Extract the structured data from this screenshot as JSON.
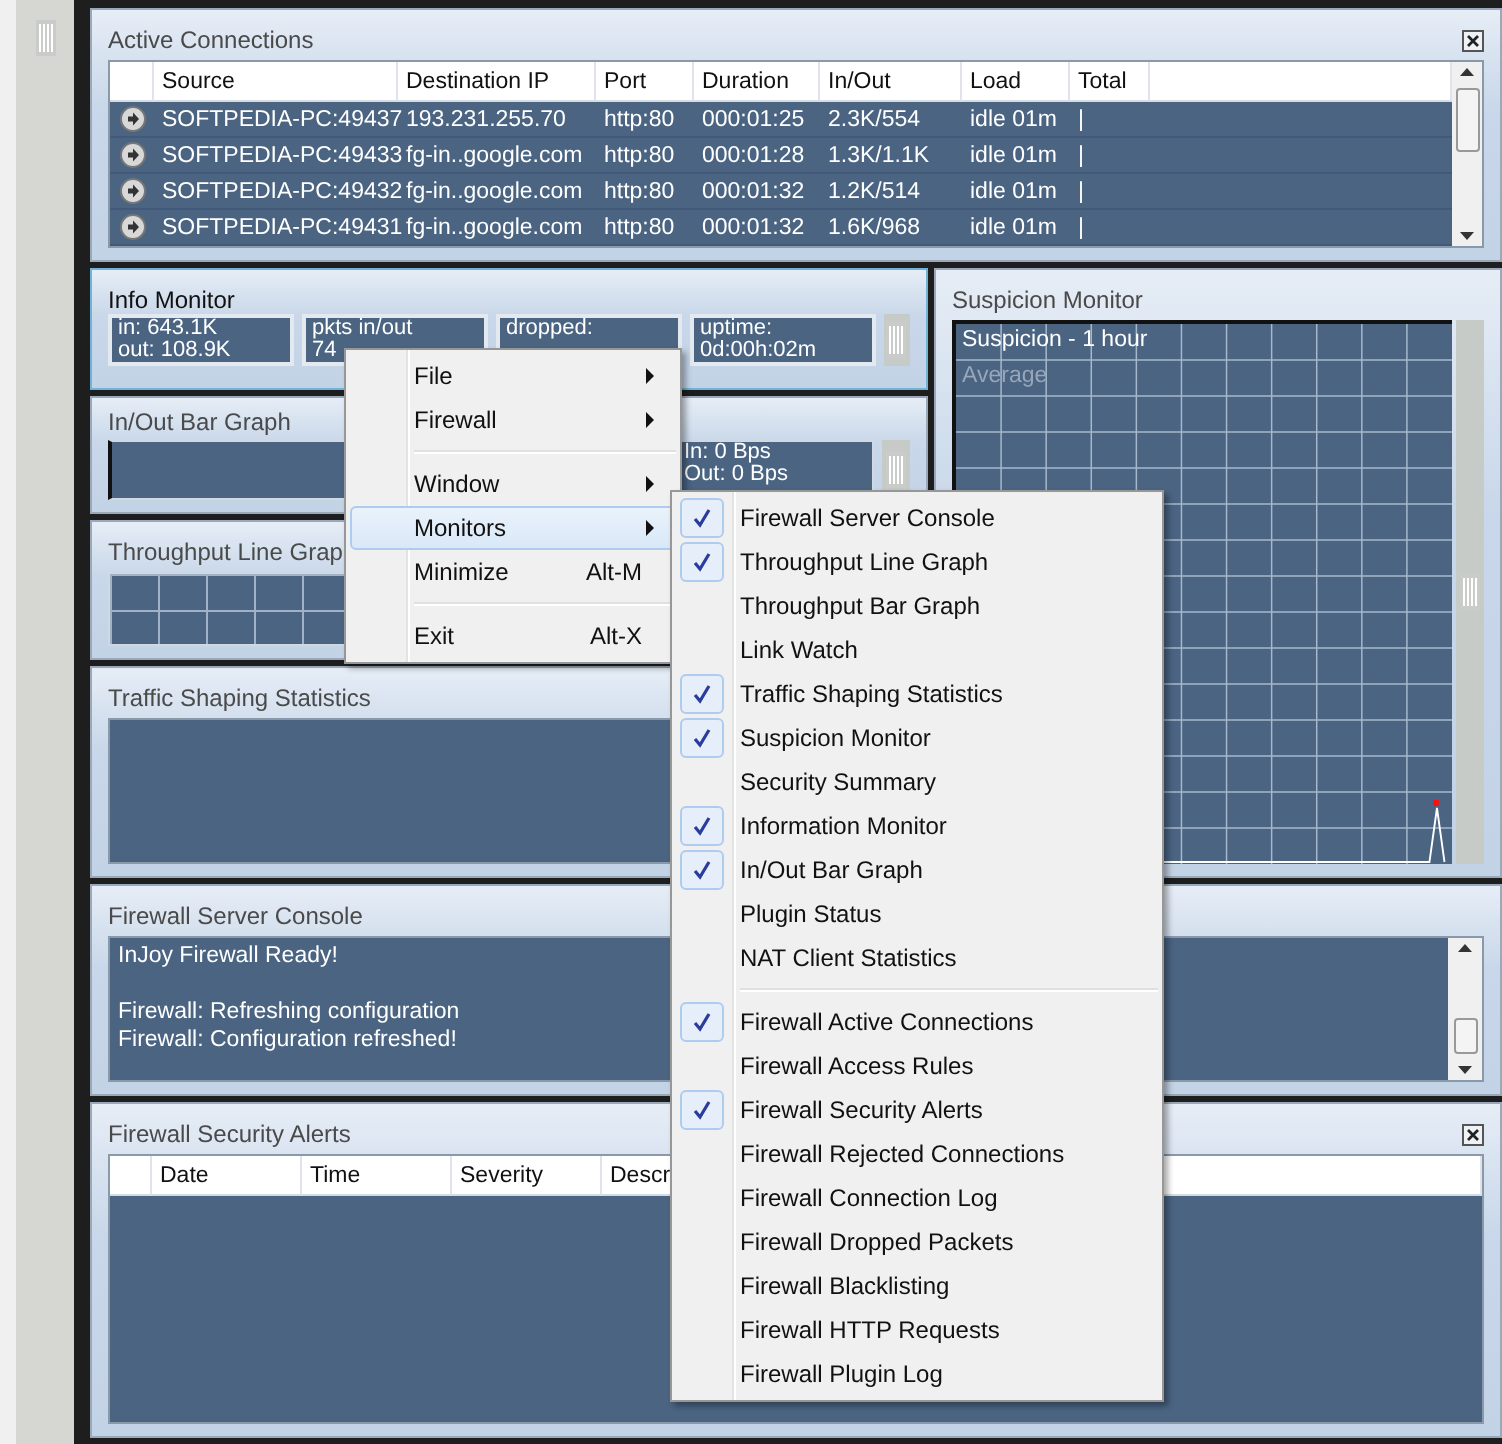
{
  "active_connections": {
    "title": "Active Connections",
    "columns": [
      "Source",
      "Destination IP",
      "Port",
      "Duration",
      "In/Out",
      "Load",
      "Total"
    ],
    "rows": [
      {
        "source": "SOFTPEDIA-PC:49437",
        "destination_ip": "193.231.255.70",
        "port": "http:80",
        "duration": "000:01:25",
        "in_out": "2.3K/554",
        "load": "idle 01m",
        "total": "|"
      },
      {
        "source": "SOFTPEDIA-PC:49433",
        "destination_ip": "fg-in..google.com",
        "port": "http:80",
        "duration": "000:01:28",
        "in_out": "1.3K/1.1K",
        "load": "idle 01m",
        "total": "|"
      },
      {
        "source": "SOFTPEDIA-PC:49432",
        "destination_ip": "fg-in..google.com",
        "port": "http:80",
        "duration": "000:01:32",
        "in_out": "1.2K/514",
        "load": "idle 01m",
        "total": "|"
      },
      {
        "source": "SOFTPEDIA-PC:49431",
        "destination_ip": "fg-in..google.com",
        "port": "http:80",
        "duration": "000:01:32",
        "in_out": "1.6K/968",
        "load": "idle 01m",
        "total": "|"
      }
    ]
  },
  "info_monitor": {
    "title": "Info Monitor",
    "stats": [
      {
        "lines": [
          "in: 643.1K",
          "out: 108.9K"
        ]
      },
      {
        "lines": [
          "pkts in/out",
          "74"
        ]
      },
      {
        "lines": [
          "dropped:"
        ]
      },
      {
        "lines": [
          "uptime:",
          "0d:00h:02m"
        ]
      }
    ]
  },
  "in_out_bar_graph": {
    "title": "In/Out Bar Graph",
    "readings": [
      "In: 0 Bps",
      "Out: 0 Bps"
    ]
  },
  "throughput_line_graph": {
    "title": "Throughput Line Grap"
  },
  "traffic_shaping_statistics": {
    "title": "Traffic Shaping Statistics"
  },
  "suspicion_monitor": {
    "title": "Suspicion Monitor",
    "graph_title": "Suspicion - 1 hour",
    "legend": "Average"
  },
  "firewall_server_console": {
    "title": "Firewall Server Console",
    "lines": [
      {
        "text": "InJoy Firewall Ready!",
        "blank_line_before": false
      },
      {
        "text": "Firewall: Refreshing configuration",
        "blank_line_before": true
      },
      {
        "text": "Firewall: Configuration refreshed!",
        "blank_line_before": false
      }
    ]
  },
  "firewall_security_alerts": {
    "title": "Firewall Security Alerts",
    "columns": [
      "Date",
      "Time",
      "Severity",
      "Descr"
    ]
  },
  "context_menu": {
    "groups": [
      {
        "items": [
          {
            "label": "File",
            "has_submenu": true,
            "selected": false
          },
          {
            "label": "Firewall",
            "has_submenu": true,
            "selected": false
          }
        ]
      },
      {
        "items": [
          {
            "label": "Window",
            "has_submenu": true,
            "selected": false
          },
          {
            "label": "Monitors",
            "has_submenu": true,
            "selected": true
          },
          {
            "label": "Minimize",
            "shortcut": "Alt-M",
            "has_submenu": false,
            "selected": false
          }
        ]
      },
      {
        "items": [
          {
            "label": "Exit",
            "shortcut": "Alt-X",
            "has_submenu": false,
            "selected": false
          }
        ]
      }
    ]
  },
  "monitors_submenu": {
    "groups": [
      {
        "items": [
          {
            "label": "Firewall Server Console",
            "checked": true
          },
          {
            "label": "Throughput Line Graph",
            "checked": true
          },
          {
            "label": "Throughput Bar Graph",
            "checked": false
          },
          {
            "label": "Link Watch",
            "checked": false
          },
          {
            "label": "Traffic Shaping Statistics",
            "checked": true
          },
          {
            "label": "Suspicion Monitor",
            "checked": true
          },
          {
            "label": "Security Summary",
            "checked": false
          },
          {
            "label": "Information Monitor",
            "checked": true
          },
          {
            "label": "In/Out Bar Graph",
            "checked": true
          },
          {
            "label": "Plugin Status",
            "checked": false
          },
          {
            "label": "NAT Client Statistics",
            "checked": false
          }
        ]
      },
      {
        "items": [
          {
            "label": "Firewall Active Connections",
            "checked": true
          },
          {
            "label": "Firewall Access Rules",
            "checked": false
          },
          {
            "label": "Firewall Security Alerts",
            "checked": true
          },
          {
            "label": "Firewall Rejected Connections",
            "checked": false
          },
          {
            "label": "Firewall Connection Log",
            "checked": false
          },
          {
            "label": "Firewall Dropped Packets",
            "checked": false
          },
          {
            "label": "Firewall Blacklisting",
            "checked": false
          },
          {
            "label": "Firewall HTTP Requests",
            "checked": false
          },
          {
            "label": "Firewall Plugin Log",
            "checked": false
          }
        ]
      }
    ]
  }
}
